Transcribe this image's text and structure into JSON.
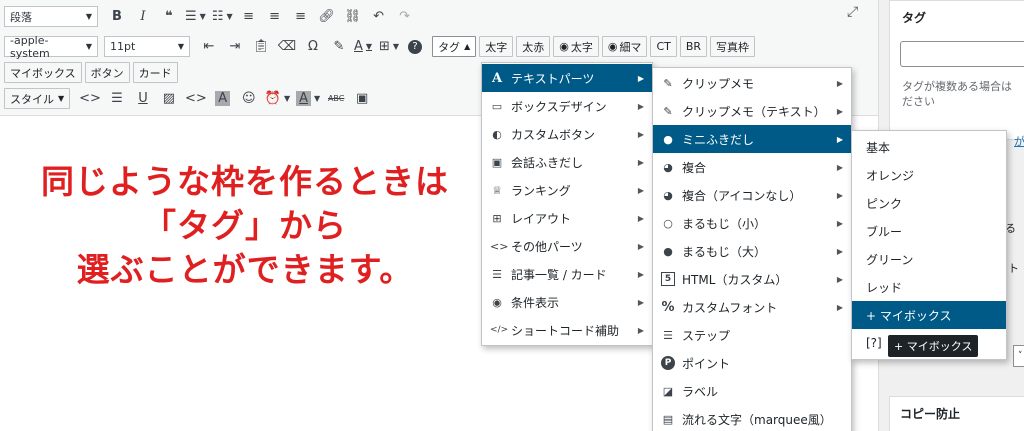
{
  "toolbar": {
    "row1": {
      "format_select": "段落",
      "bold": "B",
      "italic": "I",
      "quote": "❝"
    },
    "row2": {
      "font_family": "-apple-system",
      "font_size": "11pt",
      "omega": "Ω",
      "text_color": "A",
      "help": "?",
      "tag_button": "タグ",
      "buttons": [
        "太字",
        "太赤",
        "太字",
        "細マ",
        "CT",
        "BR",
        "写真枠"
      ]
    },
    "row3": {
      "buttons": [
        "マイボックス",
        "ボタン",
        "カード"
      ]
    },
    "row4": {
      "style_select": "スタイル",
      "underline": "U",
      "highlight": "A",
      "bg_color": "A",
      "strike": "ABC"
    }
  },
  "caption": {
    "line1": "同じような枠を作るときは",
    "line2": "「タグ」から",
    "line3": "選ぶことができます。"
  },
  "menu1": {
    "items": [
      {
        "label": "テキストパーツ",
        "icon": "A"
      },
      {
        "label": "ボックスデザイン",
        "icon": "▭"
      },
      {
        "label": "カスタムボタン",
        "icon": "◐"
      },
      {
        "label": "会話ふきだし",
        "icon": "▣"
      },
      {
        "label": "ランキング",
        "icon": "♕"
      },
      {
        "label": "レイアウト",
        "icon": "⊞"
      },
      {
        "label": "その他パーツ",
        "icon": "<>"
      },
      {
        "label": "記事一覧 / カード",
        "icon": "☰"
      },
      {
        "label": "条件表示",
        "icon": "◉"
      },
      {
        "label": "ショートコード補助",
        "icon": "</>"
      }
    ]
  },
  "menu2": {
    "items": [
      {
        "label": "クリップメモ",
        "icon": "✎"
      },
      {
        "label": "クリップメモ（テキスト）",
        "icon": "✎"
      },
      {
        "label": "ミニふきだし",
        "icon": "●"
      },
      {
        "label": "複合",
        "icon": "◕"
      },
      {
        "label": "複合（アイコンなし）",
        "icon": "◕"
      },
      {
        "label": "まるもじ（小）",
        "icon": "○"
      },
      {
        "label": "まるもじ（大）",
        "icon": "●"
      },
      {
        "label": "HTML（カスタム）",
        "icon": "5"
      },
      {
        "label": "カスタムフォント",
        "icon": "%"
      },
      {
        "label": "ステップ",
        "icon": "☰"
      },
      {
        "label": "ポイント",
        "icon": "P"
      },
      {
        "label": "ラベル",
        "icon": "◪"
      },
      {
        "label": "流れる文字（marquee風）",
        "icon": "▤"
      }
    ]
  },
  "menu3": {
    "items": [
      "基本",
      "オレンジ",
      "ピンク",
      "ブルー",
      "グリーン",
      "レッド",
      "+ マイボックス",
      "[?]"
    ],
    "partial_after_tooltip": "可"
  },
  "tooltip": "+ マイボックス",
  "sidebar": {
    "tag_panel_title": "タグ",
    "tag_hint_line1": "タグが複数ある場合は",
    "tag_hint_line2": "ださい",
    "partial_link": "が",
    "partial_text1": "る",
    "partial_text2": "ット",
    "copy_panel_title": "コピー防止"
  },
  "colors": {
    "highlight": "#005a87",
    "caption": "#e02020"
  }
}
